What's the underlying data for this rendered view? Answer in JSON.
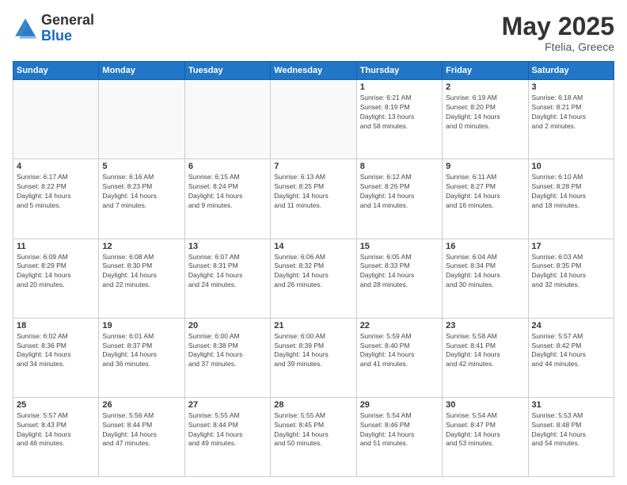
{
  "header": {
    "logo_general": "General",
    "logo_blue": "Blue",
    "month": "May 2025",
    "location": "Ftelia, Greece"
  },
  "weekdays": [
    "Sunday",
    "Monday",
    "Tuesday",
    "Wednesday",
    "Thursday",
    "Friday",
    "Saturday"
  ],
  "weeks": [
    [
      {
        "day": "",
        "info": ""
      },
      {
        "day": "",
        "info": ""
      },
      {
        "day": "",
        "info": ""
      },
      {
        "day": "",
        "info": ""
      },
      {
        "day": "1",
        "info": "Sunrise: 6:21 AM\nSunset: 8:19 PM\nDaylight: 13 hours\nand 58 minutes."
      },
      {
        "day": "2",
        "info": "Sunrise: 6:19 AM\nSunset: 8:20 PM\nDaylight: 14 hours\nand 0 minutes."
      },
      {
        "day": "3",
        "info": "Sunrise: 6:18 AM\nSunset: 8:21 PM\nDaylight: 14 hours\nand 2 minutes."
      }
    ],
    [
      {
        "day": "4",
        "info": "Sunrise: 6:17 AM\nSunset: 8:22 PM\nDaylight: 14 hours\nand 5 minutes."
      },
      {
        "day": "5",
        "info": "Sunrise: 6:16 AM\nSunset: 8:23 PM\nDaylight: 14 hours\nand 7 minutes."
      },
      {
        "day": "6",
        "info": "Sunrise: 6:15 AM\nSunset: 8:24 PM\nDaylight: 14 hours\nand 9 minutes."
      },
      {
        "day": "7",
        "info": "Sunrise: 6:13 AM\nSunset: 8:25 PM\nDaylight: 14 hours\nand 11 minutes."
      },
      {
        "day": "8",
        "info": "Sunrise: 6:12 AM\nSunset: 8:26 PM\nDaylight: 14 hours\nand 14 minutes."
      },
      {
        "day": "9",
        "info": "Sunrise: 6:11 AM\nSunset: 8:27 PM\nDaylight: 14 hours\nand 16 minutes."
      },
      {
        "day": "10",
        "info": "Sunrise: 6:10 AM\nSunset: 8:28 PM\nDaylight: 14 hours\nand 18 minutes."
      }
    ],
    [
      {
        "day": "11",
        "info": "Sunrise: 6:09 AM\nSunset: 8:29 PM\nDaylight: 14 hours\nand 20 minutes."
      },
      {
        "day": "12",
        "info": "Sunrise: 6:08 AM\nSunset: 8:30 PM\nDaylight: 14 hours\nand 22 minutes."
      },
      {
        "day": "13",
        "info": "Sunrise: 6:07 AM\nSunset: 8:31 PM\nDaylight: 14 hours\nand 24 minutes."
      },
      {
        "day": "14",
        "info": "Sunrise: 6:06 AM\nSunset: 8:32 PM\nDaylight: 14 hours\nand 26 minutes."
      },
      {
        "day": "15",
        "info": "Sunrise: 6:05 AM\nSunset: 8:33 PM\nDaylight: 14 hours\nand 28 minutes."
      },
      {
        "day": "16",
        "info": "Sunrise: 6:04 AM\nSunset: 8:34 PM\nDaylight: 14 hours\nand 30 minutes."
      },
      {
        "day": "17",
        "info": "Sunrise: 6:03 AM\nSunset: 8:35 PM\nDaylight: 14 hours\nand 32 minutes."
      }
    ],
    [
      {
        "day": "18",
        "info": "Sunrise: 6:02 AM\nSunset: 8:36 PM\nDaylight: 14 hours\nand 34 minutes."
      },
      {
        "day": "19",
        "info": "Sunrise: 6:01 AM\nSunset: 8:37 PM\nDaylight: 14 hours\nand 36 minutes."
      },
      {
        "day": "20",
        "info": "Sunrise: 6:00 AM\nSunset: 8:38 PM\nDaylight: 14 hours\nand 37 minutes."
      },
      {
        "day": "21",
        "info": "Sunrise: 6:00 AM\nSunset: 8:39 PM\nDaylight: 14 hours\nand 39 minutes."
      },
      {
        "day": "22",
        "info": "Sunrise: 5:59 AM\nSunset: 8:40 PM\nDaylight: 14 hours\nand 41 minutes."
      },
      {
        "day": "23",
        "info": "Sunrise: 5:58 AM\nSunset: 8:41 PM\nDaylight: 14 hours\nand 42 minutes."
      },
      {
        "day": "24",
        "info": "Sunrise: 5:57 AM\nSunset: 8:42 PM\nDaylight: 14 hours\nand 44 minutes."
      }
    ],
    [
      {
        "day": "25",
        "info": "Sunrise: 5:57 AM\nSunset: 8:43 PM\nDaylight: 14 hours\nand 46 minutes."
      },
      {
        "day": "26",
        "info": "Sunrise: 5:56 AM\nSunset: 8:44 PM\nDaylight: 14 hours\nand 47 minutes."
      },
      {
        "day": "27",
        "info": "Sunrise: 5:55 AM\nSunset: 8:44 PM\nDaylight: 14 hours\nand 49 minutes."
      },
      {
        "day": "28",
        "info": "Sunrise: 5:55 AM\nSunset: 8:45 PM\nDaylight: 14 hours\nand 50 minutes."
      },
      {
        "day": "29",
        "info": "Sunrise: 5:54 AM\nSunset: 8:46 PM\nDaylight: 14 hours\nand 51 minutes."
      },
      {
        "day": "30",
        "info": "Sunrise: 5:54 AM\nSunset: 8:47 PM\nDaylight: 14 hours\nand 53 minutes."
      },
      {
        "day": "31",
        "info": "Sunrise: 5:53 AM\nSunset: 8:48 PM\nDaylight: 14 hours\nand 54 minutes."
      }
    ]
  ]
}
